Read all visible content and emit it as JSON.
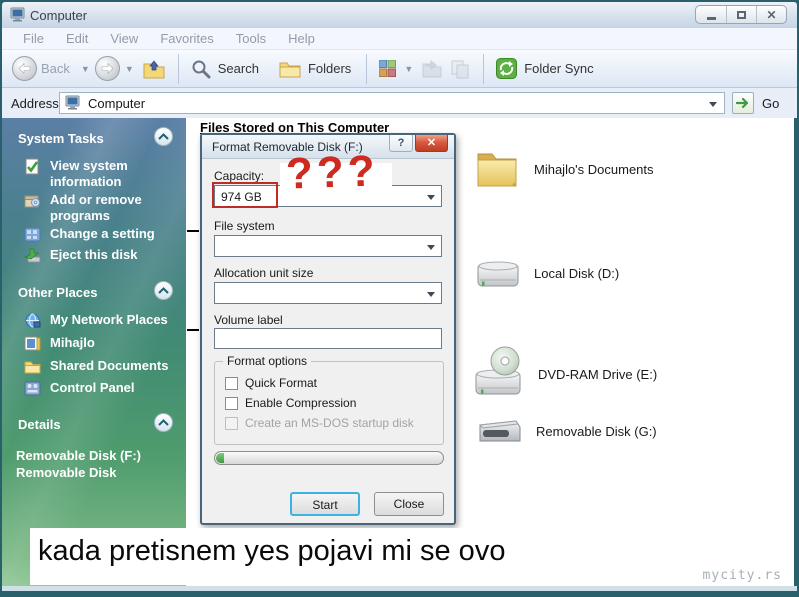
{
  "window": {
    "title": "Computer"
  },
  "menu": {
    "items": [
      "File",
      "Edit",
      "View",
      "Favorites",
      "Tools",
      "Help"
    ]
  },
  "toolbar": {
    "back": "Back",
    "search": "Search",
    "folders": "Folders",
    "folder_sync": "Folder Sync"
  },
  "address": {
    "label": "Address",
    "value": "Computer",
    "go": "Go"
  },
  "sidebar": {
    "system_tasks": {
      "title": "System Tasks",
      "items": [
        "View system information",
        "Add or remove programs",
        "Change a setting",
        "Eject this disk"
      ]
    },
    "other_places": {
      "title": "Other Places",
      "items": [
        "My Network Places",
        "Mihajlo",
        "Shared Documents",
        "Control Panel"
      ]
    },
    "details": {
      "title": "Details",
      "name": "Removable Disk (F:)",
      "type": "Removable Disk"
    }
  },
  "main": {
    "header": "Files Stored on This Computer",
    "items": [
      "Mihajlo's Documents",
      "Local Disk (D:)",
      "DVD-RAM Drive (E:)",
      "Removable Disk (G:)"
    ]
  },
  "dialog": {
    "title": "Format Removable Disk (F:)",
    "help": "?",
    "capacity_label": "Capacity:",
    "capacity_value": "974 GB",
    "annotation": "???",
    "file_system_label": "File system",
    "allocation_label": "Allocation unit size",
    "volume_label": "Volume label",
    "options_title": "Format options",
    "options": [
      "Quick Format",
      "Enable Compression",
      "Create an MS-DOS startup disk"
    ],
    "start": "Start",
    "close": "Close"
  },
  "caption": "kada pretisnem yes pojavi mi se ovo",
  "watermark": "mycity.rs",
  "colors": {
    "annotation_red": "#ce2a20",
    "sidebar_green": "#4f9c6e",
    "frame": "#2a606c",
    "close_red": "#d75b3f"
  }
}
